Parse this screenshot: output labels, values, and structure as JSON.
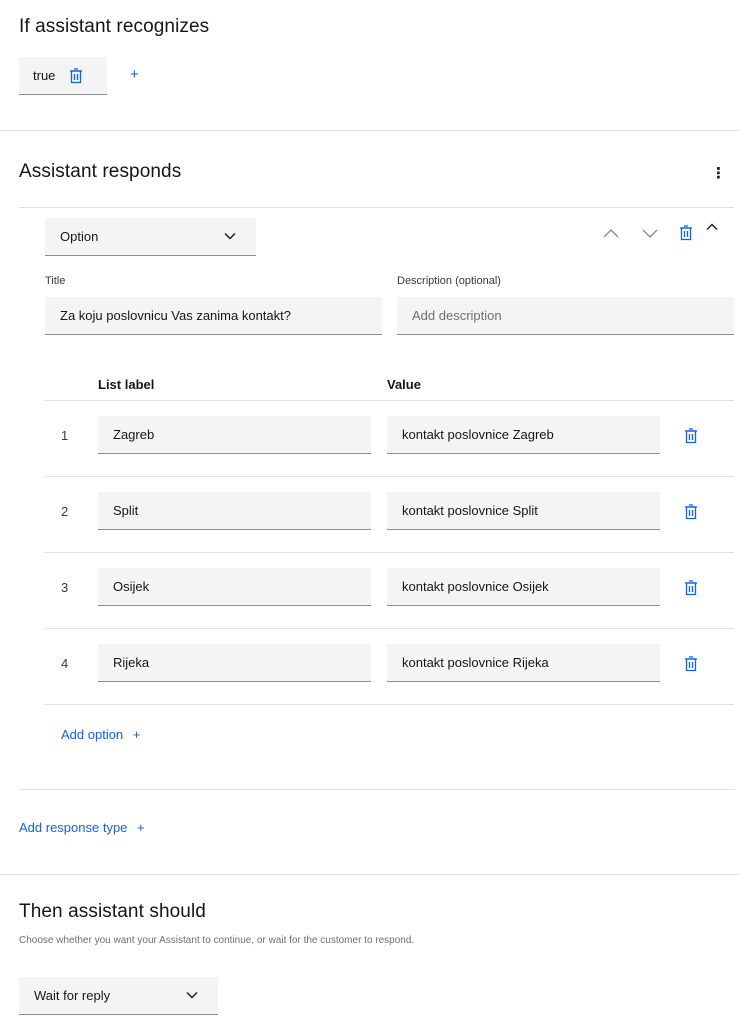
{
  "recognizes": {
    "title": "If assistant recognizes",
    "condition_value": "true",
    "add_symbol": "+"
  },
  "responds": {
    "title": "Assistant responds",
    "overflow_symbol": "⋮",
    "response_type": "Option",
    "title_label": "Title",
    "title_value": "Za koju poslovnicu Vas zanima kontakt?",
    "description_label": "Description (optional)",
    "description_placeholder": "Add description",
    "table": {
      "col_label": "List label",
      "col_value": "Value",
      "rows": [
        {
          "num": "1",
          "label": "Zagreb",
          "value": "kontakt poslovnice Zagreb"
        },
        {
          "num": "2",
          "label": "Split",
          "value": "kontakt poslovnice Split"
        },
        {
          "num": "3",
          "label": "Osijek",
          "value": "kontakt poslovnice Osijek"
        },
        {
          "num": "4",
          "label": "Rijeka",
          "value": "kontakt poslovnice Rijeka"
        }
      ]
    },
    "add_option": "Add option",
    "add_response_type": "Add response type",
    "plus_symbol": "+"
  },
  "then": {
    "title": "Then assistant should",
    "description": "Choose whether you want your Assistant to continue, or wait for the customer to respond.",
    "selected": "Wait for reply"
  },
  "colors": {
    "accent": "#0f62fe",
    "field_bg": "#f4f4f4",
    "divider": "#e0e0e0"
  },
  "icons": [
    "trash-icon",
    "plus-icon",
    "overflow-menu-icon",
    "chevron-down-icon",
    "chevron-up-icon",
    "move-up-icon",
    "move-down-icon"
  ]
}
